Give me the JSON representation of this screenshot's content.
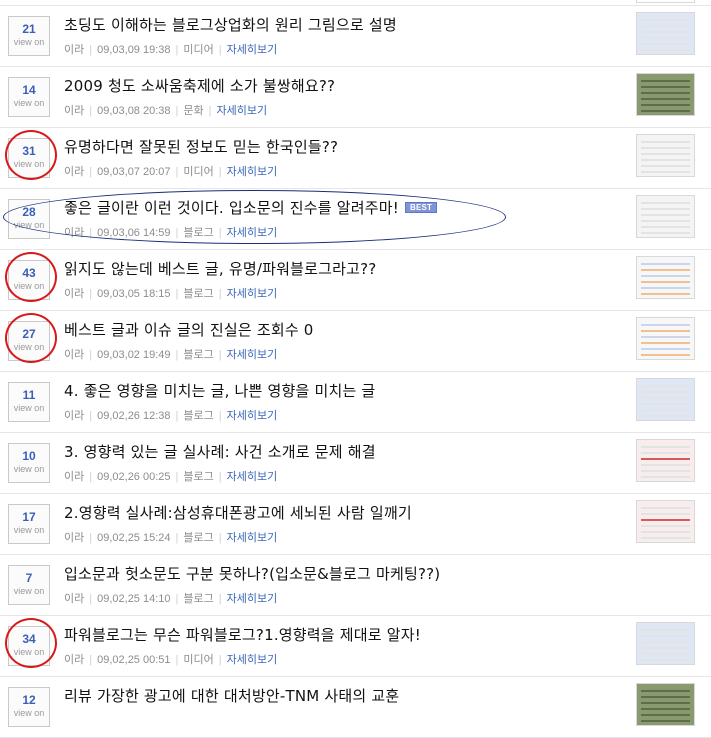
{
  "view_label": "view on",
  "more_label": "자세히보기",
  "best_label": "BEST",
  "posts": [
    {
      "count": "21",
      "title": "초딩도 이해하는 블로그상업화의 원리 그림으로 설명",
      "author": "이라",
      "date": "09,03,09 19:38",
      "category": "미디어",
      "mark": "none",
      "thumb": "blue"
    },
    {
      "count": "14",
      "title": "2009 청도 소싸움축제에 소가 불쌍해요??",
      "author": "이라",
      "date": "09,03,08 20:38",
      "category": "문화",
      "mark": "none",
      "thumb": "photo"
    },
    {
      "count": "31",
      "title": "유명하다면 잘못된 정보도 믿는 한국인들??",
      "author": "이라",
      "date": "09,03,07 20:07",
      "category": "미디어",
      "mark": "circle",
      "thumb": "table"
    },
    {
      "count": "28",
      "title": "좋은 글이란 이런 것이다. 입소문의 진수를 알려주마!",
      "author": "이라",
      "date": "09,03,06 14:59",
      "category": "블로그",
      "mark": "ellipse",
      "best": true,
      "thumb": "table"
    },
    {
      "count": "43",
      "title": "읽지도 않는데 베스트 글, 유명/파워블로그라고??",
      "author": "이라",
      "date": "09,03,05 18:15",
      "category": "블로그",
      "mark": "circle",
      "thumb": "chart"
    },
    {
      "count": "27",
      "title": "베스트 글과 이슈 글의 진실은 조회수 0",
      "author": "이라",
      "date": "09,03,02 19:49",
      "category": "블로그",
      "mark": "circle",
      "thumb": "chart"
    },
    {
      "count": "11",
      "title": "4. 좋은 영향을 미치는 글, 나쁜 영향을 미치는 글",
      "author": "이라",
      "date": "09,02,26 12:38",
      "category": "블로그",
      "mark": "none",
      "thumb": "blue"
    },
    {
      "count": "10",
      "title": "3. 영향력 있는 글 실사례: 사건 소개로 문제 해결",
      "author": "이라",
      "date": "09,02,26 00:25",
      "category": "블로그",
      "mark": "none",
      "thumb": "red"
    },
    {
      "count": "17",
      "title": "2.영향력 실사례:삼성휴대폰광고에 세뇌된 사람 일깨기",
      "author": "이라",
      "date": "09,02,25 15:24",
      "category": "블로그",
      "mark": "none",
      "thumb": "red"
    },
    {
      "count": "7",
      "title": "입소문과 헛소문도 구분 못하나?(입소문&블로그 마케팅??)",
      "author": "이라",
      "date": "09,02,25 14:10",
      "category": "블로그",
      "mark": "none",
      "thumb": "none"
    },
    {
      "count": "34",
      "title": "파워블로그는 무슨 파워블로그?1.영향력을 제대로 알자!",
      "author": "이라",
      "date": "09,02,25 00:51",
      "category": "미디어",
      "mark": "circle",
      "thumb": "blue"
    },
    {
      "count": "12",
      "title": "리뷰 가장한 광고에 대한 대처방안-TNM 사태의 교훈",
      "author": "",
      "date": "",
      "category": "",
      "mark": "none",
      "thumb": "photo"
    }
  ]
}
